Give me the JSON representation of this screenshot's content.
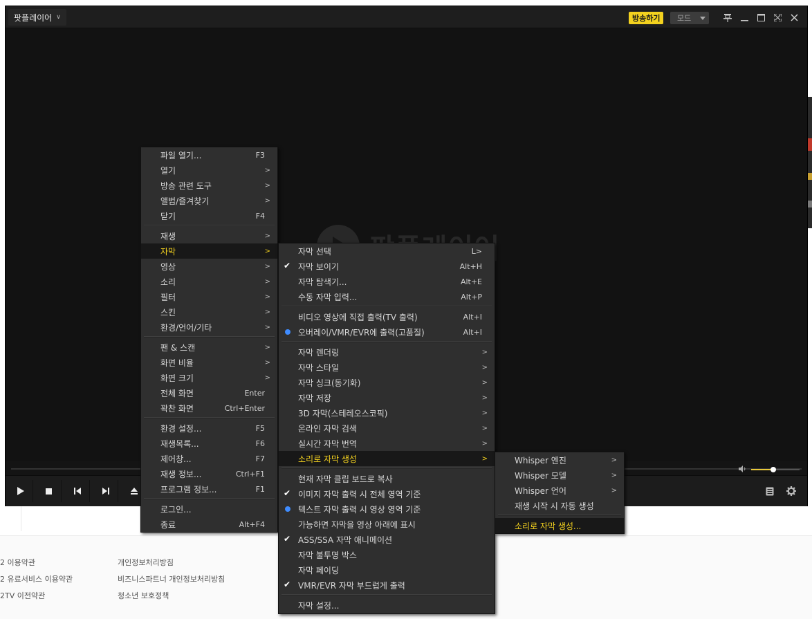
{
  "footer": {
    "links": [
      "2 이용약관",
      "2 유료서비스 이용약관",
      "2TV 이전약관",
      "개인정보처리방침",
      "비즈니스파트너 개인정보처리방침",
      "청소년 보호정책"
    ]
  },
  "player": {
    "title": "팟플레이어",
    "broadcast_label": "방송하기",
    "mode_label": "모드",
    "logo_text": "팟플레이어",
    "volume_level": 0.45
  },
  "main_menu": {
    "items": [
      {
        "label": "파일 열기...",
        "shortcut": "F3",
        "sub": ""
      },
      {
        "label": "열기",
        "shortcut": "",
        "sub": ">"
      },
      {
        "label": "방송 관련 도구",
        "shortcut": "",
        "sub": ">"
      },
      {
        "label": "앨범/즐겨찾기",
        "shortcut": "",
        "sub": ">"
      },
      {
        "label": "닫기",
        "shortcut": "F4",
        "sub": ""
      },
      {
        "label": "재생",
        "shortcut": "",
        "sub": ">"
      },
      {
        "label": "자막",
        "shortcut": "",
        "sub": ">"
      },
      {
        "label": "영상",
        "shortcut": "",
        "sub": ">"
      },
      {
        "label": "소리",
        "shortcut": "",
        "sub": ">"
      },
      {
        "label": "필터",
        "shortcut": "",
        "sub": ">"
      },
      {
        "label": "스킨",
        "shortcut": "",
        "sub": ">"
      },
      {
        "label": "환경/언어/기타",
        "shortcut": "",
        "sub": ">"
      },
      {
        "label": "팬 & 스캔",
        "shortcut": "",
        "sub": ">"
      },
      {
        "label": "화면 비율",
        "shortcut": "",
        "sub": ">"
      },
      {
        "label": "화면 크기",
        "shortcut": "",
        "sub": ">"
      },
      {
        "label": "전체 화면",
        "shortcut": "Enter",
        "sub": ""
      },
      {
        "label": "꽉찬 화면",
        "shortcut": "Ctrl+Enter",
        "sub": ""
      },
      {
        "label": "환경 설정...",
        "shortcut": "F5",
        "sub": ""
      },
      {
        "label": "재생목록...",
        "shortcut": "F6",
        "sub": ""
      },
      {
        "label": "제어창...",
        "shortcut": "F7",
        "sub": ""
      },
      {
        "label": "재생 정보...",
        "shortcut": "Ctrl+F1",
        "sub": ""
      },
      {
        "label": "프로그램 정보...",
        "shortcut": "F1",
        "sub": ""
      },
      {
        "label": "로그인...",
        "shortcut": "",
        "sub": ""
      },
      {
        "label": "종료",
        "shortcut": "Alt+F4",
        "sub": ""
      }
    ]
  },
  "subtitle_menu": {
    "items": [
      {
        "label": "자막 선택",
        "shortcut": "L>",
        "sub": "",
        "mark": ""
      },
      {
        "label": "자막 보이기",
        "shortcut": "Alt+H",
        "sub": "",
        "mark": "check"
      },
      {
        "label": "자막 탐색기...",
        "shortcut": "Alt+E",
        "sub": "",
        "mark": ""
      },
      {
        "label": "수동 자막 입력...",
        "shortcut": "Alt+P",
        "sub": "",
        "mark": ""
      },
      {
        "label": "비디오 영상에 직접 출력(TV 출력)",
        "shortcut": "Alt+I",
        "sub": "",
        "mark": ""
      },
      {
        "label": "오버레이/VMR/EVR에 출력(고품질)",
        "shortcut": "Alt+I",
        "sub": "",
        "mark": "radio"
      },
      {
        "label": "자막 렌더링",
        "shortcut": "",
        "sub": ">",
        "mark": ""
      },
      {
        "label": "자막 스타일",
        "shortcut": "",
        "sub": ">",
        "mark": ""
      },
      {
        "label": "자막 싱크(동기화)",
        "shortcut": "",
        "sub": ">",
        "mark": ""
      },
      {
        "label": "자막 저장",
        "shortcut": "",
        "sub": ">",
        "mark": ""
      },
      {
        "label": "3D 자막(스테레오스코픽)",
        "shortcut": "",
        "sub": ">",
        "mark": ""
      },
      {
        "label": "온라인 자막 검색",
        "shortcut": "",
        "sub": ">",
        "mark": ""
      },
      {
        "label": "실시간 자막 번역",
        "shortcut": "",
        "sub": ">",
        "mark": ""
      },
      {
        "label": "소리로 자막 생성",
        "shortcut": "",
        "sub": ">",
        "mark": ""
      },
      {
        "label": "현재 자막 클립 보드로 복사",
        "shortcut": "",
        "sub": "",
        "mark": ""
      },
      {
        "label": "이미지 자막 출력 시 전체 영역 기준",
        "shortcut": "",
        "sub": "",
        "mark": "check"
      },
      {
        "label": "텍스트 자막 출력 시 영상 영역 기준",
        "shortcut": "",
        "sub": "",
        "mark": "radio"
      },
      {
        "label": "가능하면 자막을 영상 아래에 표시",
        "shortcut": "",
        "sub": "",
        "mark": ""
      },
      {
        "label": "ASS/SSA 자막 애니메이션",
        "shortcut": "",
        "sub": "",
        "mark": "check"
      },
      {
        "label": "자막 불투명 박스",
        "shortcut": "",
        "sub": "",
        "mark": ""
      },
      {
        "label": "자막 페이딩",
        "shortcut": "",
        "sub": "",
        "mark": ""
      },
      {
        "label": "VMR/EVR 자막 부드럽게 출력",
        "shortcut": "",
        "sub": "",
        "mark": "check"
      },
      {
        "label": "자막 설정...",
        "shortcut": "",
        "sub": "",
        "mark": ""
      }
    ]
  },
  "whisper_menu": {
    "items": [
      {
        "label": "Whisper 엔진",
        "sub": ">"
      },
      {
        "label": "Whisper 모델",
        "sub": ">"
      },
      {
        "label": "Whisper 언어",
        "sub": ">"
      },
      {
        "label": "재생 시작 시 자동 생성",
        "sub": ""
      },
      {
        "label": "소리로 자막 생성...",
        "sub": ""
      }
    ]
  }
}
